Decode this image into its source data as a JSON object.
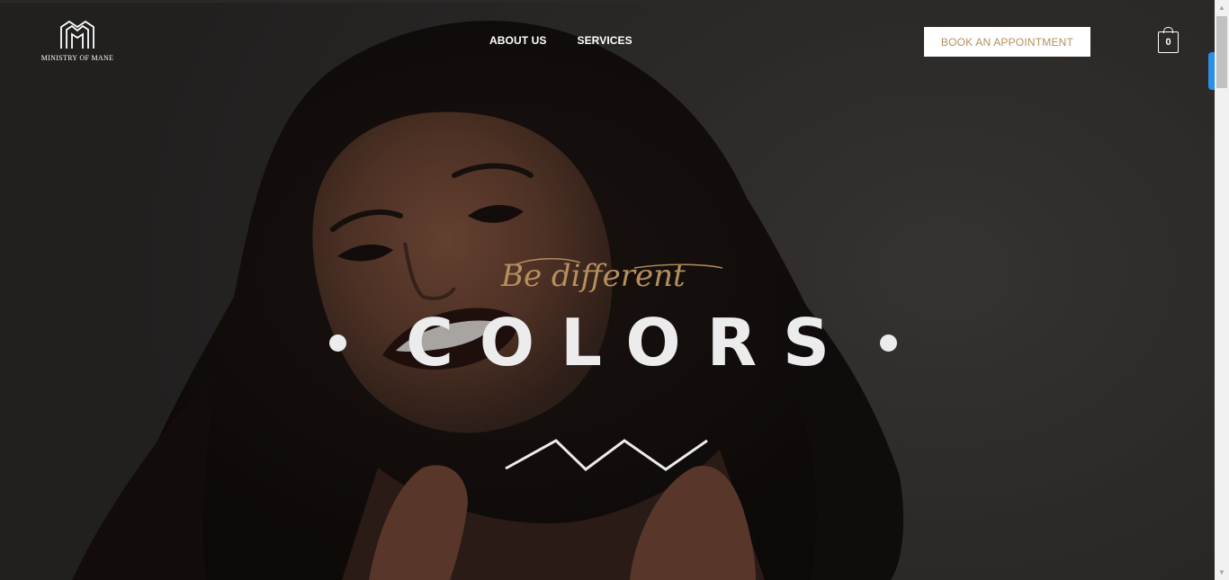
{
  "brand": {
    "name": "MINISTRY OF MANE",
    "logo_icon": "mm-monogram-icon"
  },
  "nav": {
    "items": [
      {
        "label": "ABOUT US"
      },
      {
        "label": "SERVICES"
      }
    ]
  },
  "header": {
    "book_label": "BOOK AN APPOINTMENT",
    "cart_count": "0",
    "cart_icon": "shopping-bag-icon"
  },
  "hero": {
    "tagline": "Be different",
    "headline": "COLORS",
    "decor_icon": "zigzag-icon"
  },
  "colors": {
    "accent": "#b68f5e",
    "background": "#3a3836",
    "headline": "#ececec",
    "scroll_accent": "#2b8fe8"
  }
}
